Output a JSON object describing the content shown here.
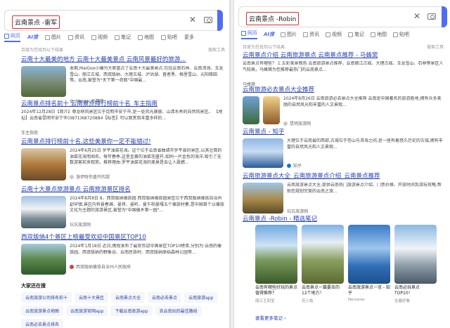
{
  "left": {
    "query": "云南景点 -雷军",
    "tabs": [
      "网页",
      "AI搜",
      "图片",
      "资讯",
      "视频",
      "笔记",
      "地图",
      "贴吧",
      "更多"
    ],
    "note": "百度为您找到以下结果",
    "tool": "搜索工具",
    "results": [
      {
        "title": "云南十大最美的地方 云南十大最美景点 云南风景最好的旅游...",
        "text": "本期,MaiGoo小编为大家盘点了云南十大最美景点,包括云南石林、云南洱海、玉龙雪山、丽江古城、西双版纳、大理古城、泸沽湖、普者黑、梅里雪山、元阳梯田等。云南,被誉为\"天下第一奇观\"中国最...",
        "source": "Maigoo品牌榜"
      },
      {
        "title": "云南景点排名前十 云南景点排行榜前十名_车主指南",
        "text": "2024年12月28日【简介】尊龙峡风景区位于昆明市安宁市,是一处风光旖旎、山清水秀的自然风景区。 【地址】云南省昆明市安宁市(0871)68720884【标签】可以观赏到丰富多样的...",
        "source": "车主指南"
      },
      {
        "title": "云南景点排行榜前十名,这些美景你一定不能错过!",
        "text": "2024年6月25日 罗平油菜花海。这个位于云南省曲靖市罗平县的景区,以其壮观的油菜花海而闻名。每年春季,这里金黄的油菜花盛开,如同一片金色的海洋,吸引了无数游客前来观赏。推荐理由:罗平油菜花海的美景是会让人震撼...",
        "source": "洛伊呀你盛开的甜"
      },
      {
        "title": "云南十大景点旅游景点 云南旅游景区排名",
        "text": "2024年8月8日 8、西双版纳傣族园 西双版纳傣族园景区位于西双版纳傣族自治州勐罕镇,景区内有曼春满、曼将、曼听、曼乍和曼嘎五个傣族村寨,是中国首个以傣族文化为主题的旅游景区,被誉为\"中国傣乡第一园\"...",
        "source": "坑坑旅游网"
      },
      {
        "title": "西双版纳4个景区上榜最受欢迎中国景区TOP10",
        "text": "2024年1月18日 近日,携程发布了最受欢迎中国景区TOP10榜单,分别为:云南的傣族园、西双版纳的野象谷、云南民族村、西双版纳原始森林公园等...",
        "source": "西双版纳傣族自治州人民政府"
      }
    ],
    "related_title": "大家还在搜",
    "related": [
      "云南旅游公司排名前十",
      "云南十大景区",
      "云南景点大全",
      "云南必去景点",
      "云南旅游app",
      "云南旅游景点地图",
      "云南旅游官网app",
      "下载云南旅游app",
      "去云南玩的最佳路线",
      "云南必去景点排名"
    ]
  },
  "right": {
    "query": "云南景点 -Robin",
    "tabs": [
      "网页",
      "AI搜",
      "图片",
      "资讯",
      "视频",
      "笔记",
      "地图",
      "贴吧"
    ],
    "note": "百度为您找到以下结果",
    "tool": "搜索工具",
    "results": [
      {
        "title": "云南景点介绍 云南旅游景点 云南景点推荐 - 马蜂窝",
        "text": "云南景点有哪些？ 1.五彩美景观色 云南旅游景点推荐，云南丽江古城、大理古城、玉龙雪山、石林等景区人气较高，马蜂窝为您推荐最热门的云南景点...",
        "source": "马蜂窝"
      },
      {
        "title": "云南旅游必去景点大全推荐",
        "text": "2024年8月26日 云南旅游必去景点大全推荐 云南是中国著名的旅游胜地,拥有众多美丽的自然风光和丰富的人文景观...",
        "source": "昆明旅游网"
      },
      {
        "title": "云南景点 - 知乎",
        "text": "大理位于云南省的西部,古城位于苍山与洱海之间,是一座有着悠久历史的古城,拥有丰富的自然风光和人文景观...",
        "source": "知乎"
      },
      {
        "title": "云南旅游景点大全_云南旅游景点介绍_云南景点推荐",
        "text": "云南旅游景点大全,提供云南热门旅游景点介绍、门票价格、开放时间及游玩攻略,帮助您规划完美的云南之旅...",
        "source": "坑坑旅游网"
      }
    ],
    "notes_title": "云南景点 -Robin - 精选笔记",
    "notes": [
      {
        "title": "云南有哪些好玩的景点值得推荐？",
        "by": "丽江王四宝"
      },
      {
        "title": "云南景点一篇要去的12个地方！",
        "by": "花小兔"
      },
      {
        "title": "云南旅游景点一览 - 知乎",
        "by": "Nerverer"
      },
      {
        "title": "云南必玩景点TOP10！",
        "by": "住着好看"
      }
    ],
    "more": "查看更多笔记 ›"
  }
}
